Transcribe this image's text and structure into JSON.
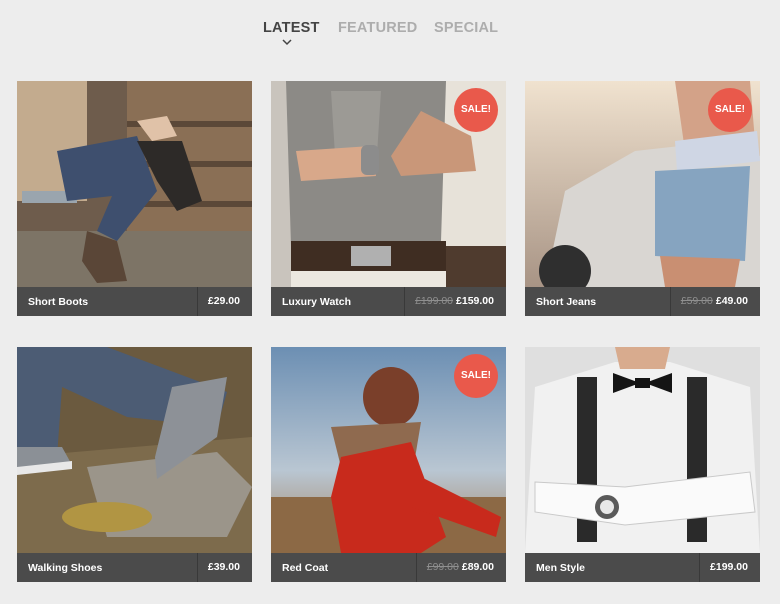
{
  "tabs": [
    {
      "label": "LATEST",
      "active": true
    },
    {
      "label": "FEATURED",
      "active": false
    },
    {
      "label": "SPECIAL",
      "active": false
    }
  ],
  "products": [
    {
      "name": "Short Boots",
      "price": "£29.00",
      "old_price": "",
      "sale": ""
    },
    {
      "name": "Luxury Watch",
      "price": "£159.00",
      "old_price": "£199.00",
      "sale": "SALE!"
    },
    {
      "name": "Short Jeans",
      "price": "£49.00",
      "old_price": "£59.00",
      "sale": "SALE!"
    },
    {
      "name": "Walking Shoes",
      "price": "£39.00",
      "old_price": "",
      "sale": ""
    },
    {
      "name": "Red Coat",
      "price": "£89.00",
      "old_price": "£99.00",
      "sale": "SALE!"
    },
    {
      "name": "Men Style",
      "price": "£199.00",
      "old_price": "",
      "sale": ""
    }
  ],
  "colors": {
    "background": "#ededed",
    "bar": "#4b4b4b",
    "sale_badge": "#e9594b",
    "tab_active": "#444444",
    "tab_inactive": "#adadad"
  }
}
